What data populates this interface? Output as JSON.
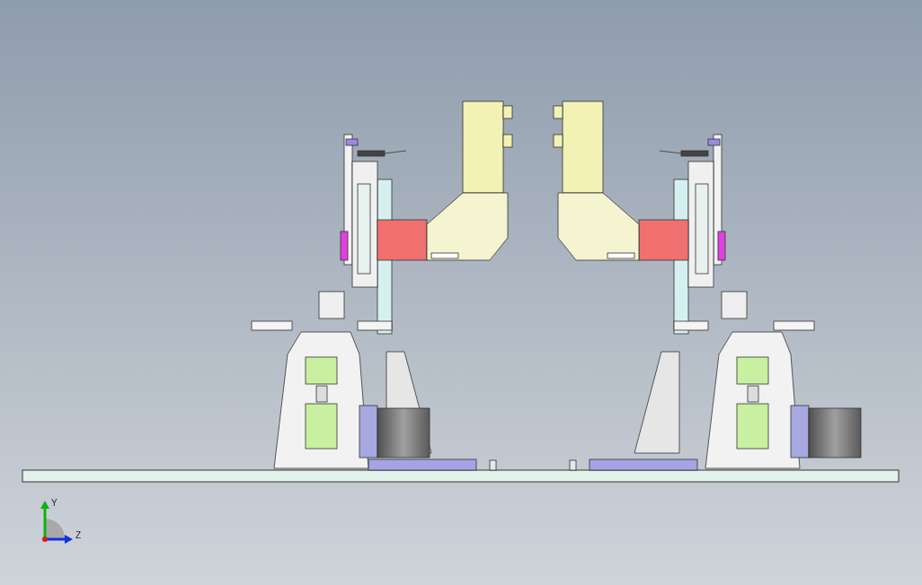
{
  "viewport": {
    "triad": {
      "axes": [
        {
          "label": "Y"
        },
        {
          "label": "Z"
        }
      ]
    }
  }
}
